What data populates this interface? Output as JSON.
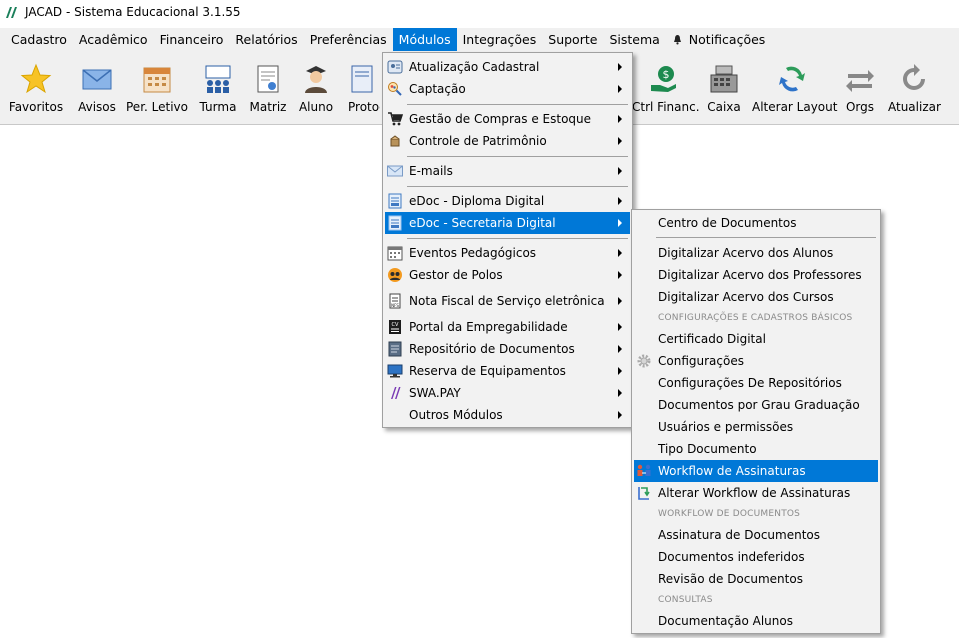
{
  "window": {
    "title": "JACAD - Sistema Educacional 3.1.55"
  },
  "menubar": {
    "items": [
      "Cadastro",
      "Acadêmico",
      "Financeiro",
      "Relatórios",
      "Preferências",
      "Módulos",
      "Integrações",
      "Suporte",
      "Sistema",
      "Notificações"
    ],
    "active": "Módulos"
  },
  "toolbar": {
    "buttons": [
      "Favoritos",
      "Avisos",
      "Per. Letivo",
      "Turma",
      "Matriz",
      "Aluno",
      "Protoc",
      "Ctrl Financ.",
      "Caixa",
      "Alterar Layout",
      "Orgs",
      "Atualizar"
    ]
  },
  "modulos_menu": {
    "items": [
      "Atualização Cadastral",
      "Captação",
      "Gestão de Compras e Estoque",
      "Controle de Patrimônio",
      "E-mails",
      "eDoc - Diploma Digital",
      "eDoc - Secretaria Digital",
      "Eventos Pedagógicos",
      "Gestor de Polos",
      "Nota Fiscal de Serviço eletrônica",
      "Portal da Empregabilidade",
      "Repositório de Documentos",
      "Reserva de Equipamentos",
      "SWA.PAY",
      "Outros Módulos"
    ],
    "highlighted": "eDoc - Secretaria Digital"
  },
  "secretaria_submenu": {
    "items": [
      "Centro de Documentos",
      "Digitalizar Acervo dos Alunos",
      "Digitalizar Acervo dos Professores",
      "Digitalizar Acervo dos Cursos",
      "Certificado Digital",
      "Configurações",
      "Configurações De Repositórios",
      "Documentos por Grau Graduação",
      "Usuários e permissões",
      "Tipo Documento",
      "Workflow de Assinaturas",
      "Alterar Workflow de Assinaturas",
      "Assinatura de Documentos",
      "Documentos indeferidos",
      "Revisão de Documentos",
      "Documentação Alunos"
    ],
    "headers": [
      "CONFIGURAÇÕES E CADASTROS BÁSICOS",
      "WORKFLOW DE DOCUMENTOS",
      "CONSULTAS"
    ],
    "highlighted": "Workflow de Assinaturas"
  },
  "colors": {
    "highlight": "#0078d7",
    "menu_bg": "#f2f2f2",
    "bar_bg": "#f0f0f0"
  }
}
